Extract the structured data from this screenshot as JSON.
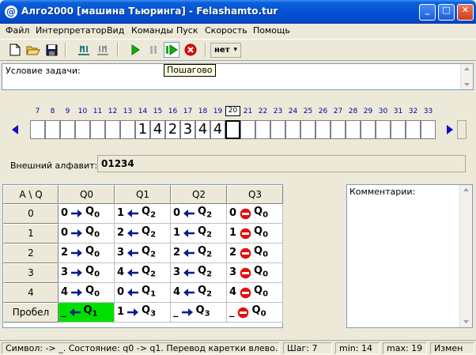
{
  "window": {
    "title": "Алго2000 [машина Тьюринга] - Felashamto.tur",
    "icon": "@",
    "minimize": "_",
    "maximize": "□",
    "close": "✕"
  },
  "menu": [
    "Файл",
    "Интерпретатор",
    "Вид",
    "Команды",
    "Пуск",
    "Скорость",
    "Помощь"
  ],
  "toolbar": {
    "speed_value": "нет",
    "speed_arrow": "▾",
    "tooltip": "Пошагово",
    "icons": [
      "new-file-icon",
      "open-folder-icon",
      "save-icon",
      "tape-in-icon",
      "tape-out-icon",
      "run-icon",
      "pause-icon",
      "step-icon",
      "stop-icon"
    ]
  },
  "task": {
    "label": "Условие задачи:"
  },
  "tape": {
    "numbers": [
      "7",
      "8",
      "9",
      "10",
      "11",
      "12",
      "13",
      "14",
      "15",
      "16",
      "17",
      "18",
      "19",
      "20",
      "21",
      "22",
      "23",
      "24",
      "25",
      "26",
      "27",
      "28",
      "29",
      "30",
      "31",
      "32",
      "33"
    ],
    "current_number": "20",
    "cells": [
      "",
      "",
      "",
      "",
      "",
      "",
      "",
      "1",
      "4",
      "2",
      "3",
      "4",
      "4",
      "",
      "",
      "",
      "",
      "",
      "",
      "",
      "",
      "",
      "",
      "",
      "",
      "",
      ""
    ],
    "head_index": 13
  },
  "alphabet": {
    "label": "Внешний алфавит:",
    "value": "01234"
  },
  "rules": {
    "corner": "A \\ Q",
    "states": [
      "Q0",
      "Q1",
      "Q2",
      "Q3"
    ],
    "symbols": [
      "0",
      "1",
      "2",
      "3",
      "4",
      "Пробел"
    ],
    "cells": [
      [
        {
          "s": "0",
          "d": "R",
          "q": "Q",
          "n": "0"
        },
        {
          "s": "1",
          "d": "L",
          "q": "Q",
          "n": "2"
        },
        {
          "s": "0",
          "d": "L",
          "q": "Q",
          "n": "2"
        },
        {
          "s": "0",
          "d": "S",
          "q": "Q",
          "n": "0"
        }
      ],
      [
        {
          "s": "0",
          "d": "R",
          "q": "Q",
          "n": "0"
        },
        {
          "s": "2",
          "d": "L",
          "q": "Q",
          "n": "2"
        },
        {
          "s": "1",
          "d": "L",
          "q": "Q",
          "n": "2"
        },
        {
          "s": "1",
          "d": "S",
          "q": "Q",
          "n": "0"
        }
      ],
      [
        {
          "s": "2",
          "d": "R",
          "q": "Q",
          "n": "0"
        },
        {
          "s": "3",
          "d": "L",
          "q": "Q",
          "n": "2"
        },
        {
          "s": "2",
          "d": "L",
          "q": "Q",
          "n": "2"
        },
        {
          "s": "2",
          "d": "S",
          "q": "Q",
          "n": "0"
        }
      ],
      [
        {
          "s": "3",
          "d": "R",
          "q": "Q",
          "n": "0"
        },
        {
          "s": "4",
          "d": "L",
          "q": "Q",
          "n": "2"
        },
        {
          "s": "3",
          "d": "L",
          "q": "Q",
          "n": "2"
        },
        {
          "s": "3",
          "d": "S",
          "q": "Q",
          "n": "0"
        }
      ],
      [
        {
          "s": "4",
          "d": "R",
          "q": "Q",
          "n": "0"
        },
        {
          "s": "0",
          "d": "L",
          "q": "Q",
          "n": "1"
        },
        {
          "s": "4",
          "d": "L",
          "q": "Q",
          "n": "2"
        },
        {
          "s": "4",
          "d": "S",
          "q": "Q",
          "n": "0"
        }
      ],
      [
        {
          "s": "_",
          "d": "L",
          "q": "Q",
          "n": "1",
          "active": true
        },
        {
          "s": "1",
          "d": "R",
          "q": "Q",
          "n": "3"
        },
        {
          "s": "_",
          "d": "R",
          "q": "Q",
          "n": "3"
        },
        {
          "s": "_",
          "d": "S",
          "q": "Q",
          "n": "0"
        }
      ]
    ]
  },
  "comments": {
    "label": "Комментарии:"
  },
  "status": {
    "message": "Символ:  -> _.   Состояние: q0 -> q1.   Перевод каретки влево.",
    "step": "Шаг:   7",
    "min": "min: 14",
    "max": "max: 19",
    "mode": "Измен"
  },
  "colors": {
    "active_cell": "#00e000",
    "arrow": "#0a1a8a",
    "stop": "#e01010",
    "tape_arrow": "#1010c0"
  }
}
